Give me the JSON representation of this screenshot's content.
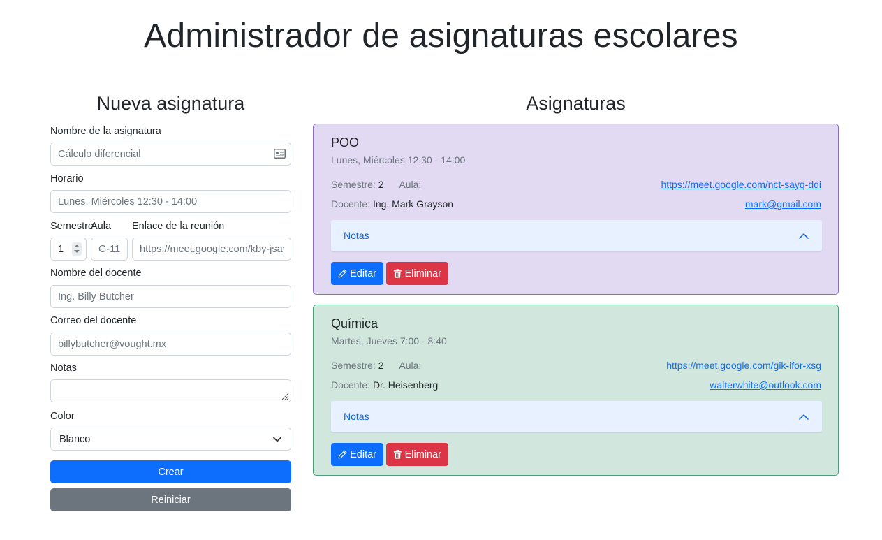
{
  "page": {
    "title": "Administrador de asignaturas escolares"
  },
  "form": {
    "title": "Nueva asignatura",
    "subject_label": "Nombre de la asignatura",
    "subject_placeholder": "Cálculo diferencial",
    "schedule_label": "Horario",
    "schedule_placeholder": "Lunes, Miércoles 12:30 - 14:00",
    "semester_label": "Semestre",
    "semester_value": "1",
    "room_label": "Aula",
    "room_placeholder": "G-11",
    "meeting_label": "Enlace de la reunión",
    "meeting_placeholder": "https://meet.google.com/kby-jsay-mzk",
    "teacher_label": "Nombre del docente",
    "teacher_placeholder": "Ing. Billy Butcher",
    "email_label": "Correo del docente",
    "email_placeholder": "billybutcher@vought.mx",
    "notes_label": "Notas",
    "notes_value": "",
    "color_label": "Color",
    "color_value": "Blanco",
    "create_label": "Crear",
    "reset_label": "Reiniciar"
  },
  "list": {
    "title": "Asignaturas",
    "notes_label": "Notas",
    "edit_label": "Editar",
    "delete_label": "Eliminar",
    "semester_caption": "Semestre:",
    "room_caption": "Aula:",
    "teacher_caption": "Docente:",
    "cards": [
      {
        "name": "POO",
        "schedule": "Lunes, Miércoles 12:30 - 14:00",
        "semester": "2",
        "room": "",
        "teacher": "Ing. Mark Grayson",
        "meeting": "https://meet.google.com/nct-sayq-ddi",
        "email": "mark@gmail.com",
        "bg": "#e2d9f3",
        "border": "#8c68cd"
      },
      {
        "name": "Química",
        "schedule": "Martes, Jueves 7:00 - 8:40",
        "semester": "2",
        "room": "",
        "teacher": "Dr. Heisenberg",
        "meeting": "https://meet.google.com/gik-ifor-xsg",
        "email": "walterwhite@outlook.com",
        "bg": "#d1e7dd",
        "border": "#479f76"
      }
    ]
  },
  "colors": {
    "primary": "#0d6efd",
    "secondary": "#6c757d",
    "danger": "#dc3545",
    "accordion": "#e7f1ff"
  }
}
